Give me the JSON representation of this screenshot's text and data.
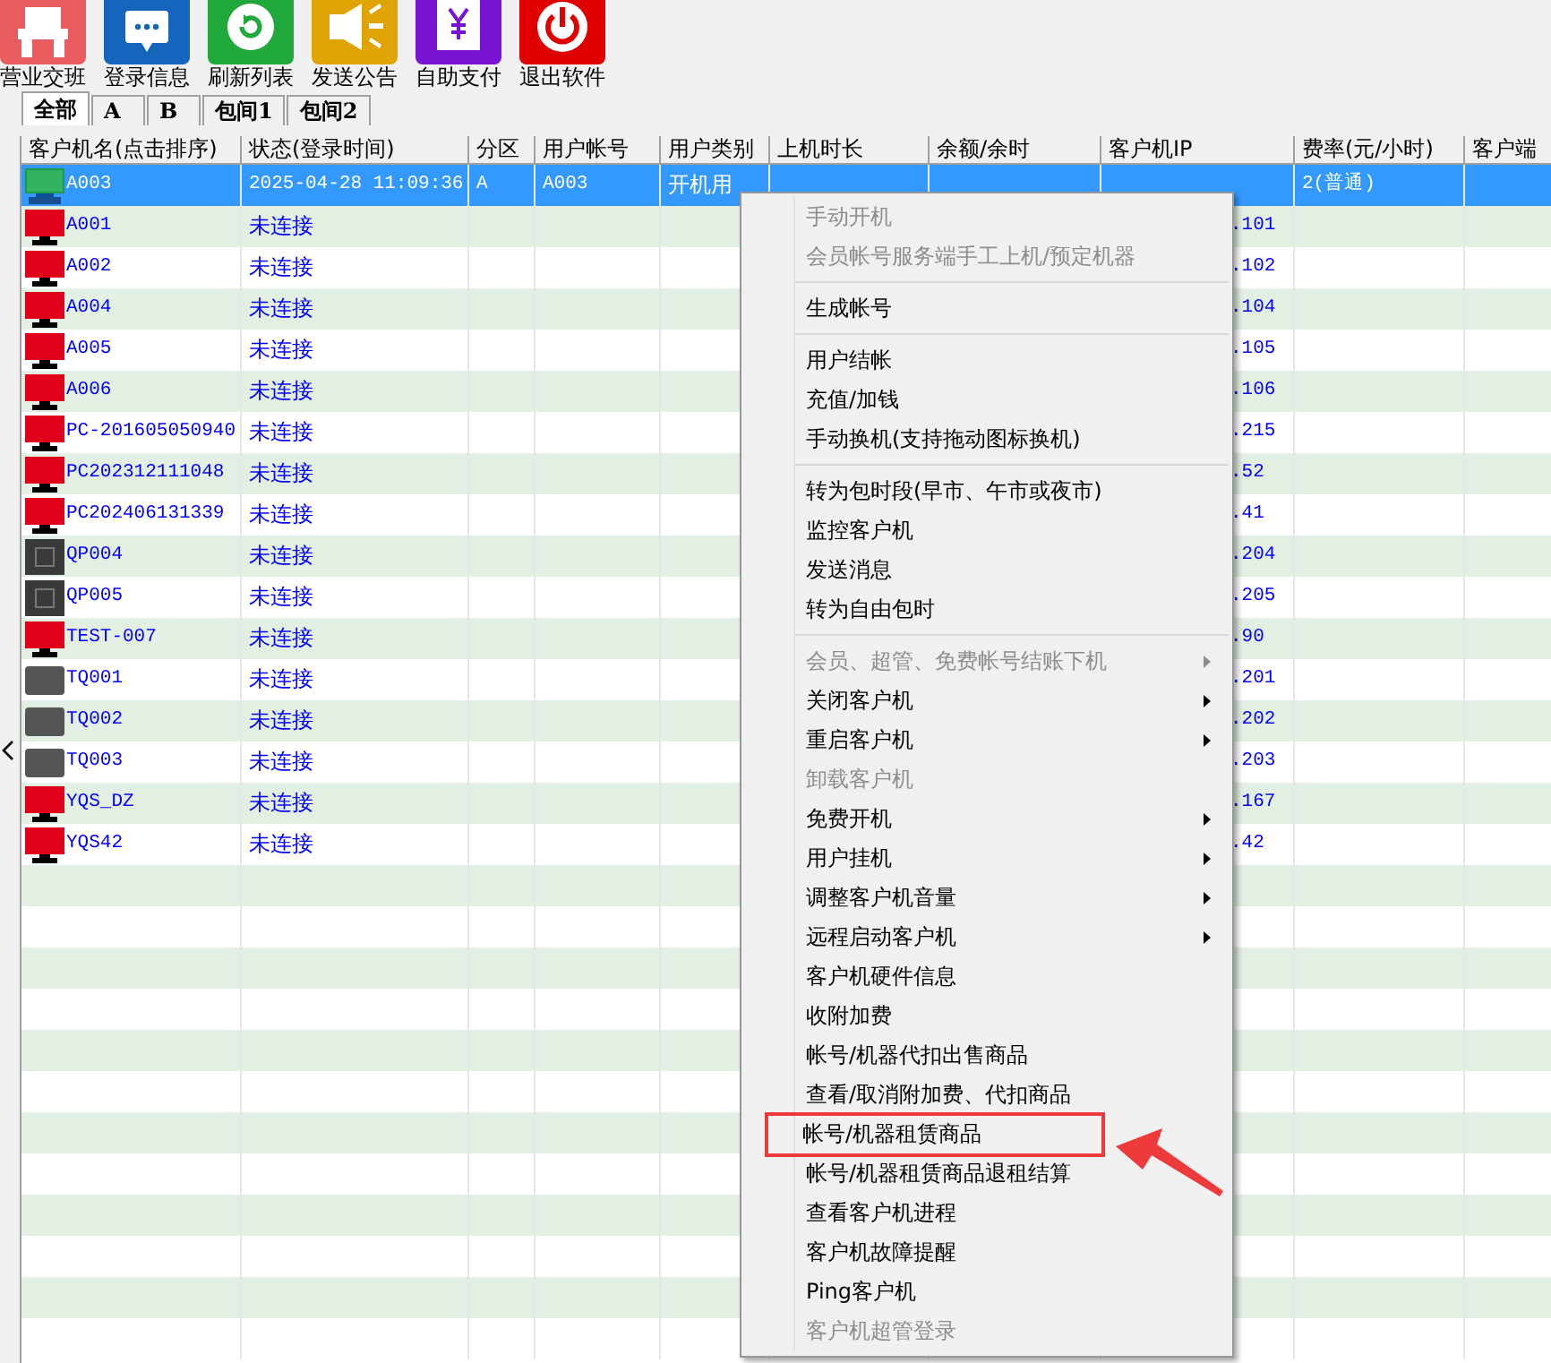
{
  "toolbar": [
    {
      "label": "营业交班",
      "kind": "shift"
    },
    {
      "label": "登录信息",
      "kind": "info"
    },
    {
      "label": "刷新列表",
      "kind": "refresh"
    },
    {
      "label": "发送公告",
      "kind": "announce"
    },
    {
      "label": "自助支付",
      "kind": "pay"
    },
    {
      "label": "退出软件",
      "kind": "exit"
    }
  ],
  "tabs": [
    {
      "label": "全部",
      "selected": true
    },
    {
      "label": "A",
      "selected": false
    },
    {
      "label": "B",
      "selected": false
    },
    {
      "label": "包间1",
      "selected": false
    },
    {
      "label": "包间2",
      "selected": false
    }
  ],
  "table": {
    "columns": [
      "客户机名(点击排序)",
      "状态(登录时间)",
      "分区",
      "用户帐号",
      "用户类别",
      "上机时长",
      "余额/余时",
      "客户机IP",
      "费率(元/小时)",
      "客户端"
    ],
    "rows": [
      {
        "name": "A003",
        "kind": "connected",
        "selected": true,
        "status": "2025-04-28 11:09:36",
        "zone": "A",
        "account": "A003",
        "user_type": "开机用",
        "rate": "2(普通)"
      },
      {
        "name": "A001",
        "kind": "offline",
        "selected": false,
        "status": "未连接",
        "ip": ".101"
      },
      {
        "name": "A002",
        "kind": "offline",
        "selected": false,
        "status": "未连接",
        "ip": ".102"
      },
      {
        "name": "A004",
        "kind": "offline",
        "selected": false,
        "status": "未连接",
        "ip": ".104"
      },
      {
        "name": "A005",
        "kind": "offline",
        "selected": false,
        "status": "未连接",
        "ip": ".105"
      },
      {
        "name": "A006",
        "kind": "offline",
        "selected": false,
        "status": "未连接",
        "ip": ".106"
      },
      {
        "name": "PC-201605050940",
        "kind": "offline",
        "selected": false,
        "status": "未连接",
        "ip": ".215"
      },
      {
        "name": "PC202312111048",
        "kind": "offline",
        "selected": false,
        "status": "未连接",
        "ip": ".52"
      },
      {
        "name": "PC202406131339",
        "kind": "offline",
        "selected": false,
        "status": "未连接",
        "ip": ".41"
      },
      {
        "name": "QP004",
        "kind": "special",
        "selected": false,
        "status": "未连接",
        "ip": ".204"
      },
      {
        "name": "QP005",
        "kind": "special",
        "selected": false,
        "status": "未连接",
        "ip": ".205"
      },
      {
        "name": "TEST-007",
        "kind": "offline",
        "selected": false,
        "status": "未连接",
        "ip": ".90"
      },
      {
        "name": "TQ001",
        "kind": "dormant",
        "selected": false,
        "status": "未连接",
        "ip": ".201"
      },
      {
        "name": "TQ002",
        "kind": "dormant",
        "selected": false,
        "status": "未连接",
        "ip": ".202"
      },
      {
        "name": "TQ003",
        "kind": "dormant",
        "selected": false,
        "status": "未连接",
        "ip": ".203"
      },
      {
        "name": "YQS_DZ",
        "kind": "offline",
        "selected": false,
        "status": "未连接",
        "ip": ".167"
      },
      {
        "name": "YQS42",
        "kind": "offline",
        "selected": false,
        "status": "未连接",
        "ip": ".42"
      }
    ]
  },
  "context_menu": [
    {
      "kind": "item",
      "label": "手动开机",
      "disabled": true,
      "submenu": false,
      "highlighted": false
    },
    {
      "kind": "item",
      "label": "会员帐号服务端手工上机/预定机器",
      "disabled": true,
      "submenu": false,
      "highlighted": false
    },
    {
      "kind": "separator"
    },
    {
      "kind": "item",
      "label": "生成帐号",
      "disabled": false,
      "submenu": false,
      "highlighted": false
    },
    {
      "kind": "separator"
    },
    {
      "kind": "item",
      "label": "用户结帐",
      "disabled": false,
      "submenu": false,
      "highlighted": false
    },
    {
      "kind": "item",
      "label": "充值/加钱",
      "disabled": false,
      "submenu": false,
      "highlighted": false
    },
    {
      "kind": "item",
      "label": "手动换机(支持拖动图标换机)",
      "disabled": false,
      "submenu": false,
      "highlighted": false
    },
    {
      "kind": "separator"
    },
    {
      "kind": "item",
      "label": "转为包时段(早市、午市或夜市)",
      "disabled": false,
      "submenu": false,
      "highlighted": false
    },
    {
      "kind": "item",
      "label": "监控客户机",
      "disabled": false,
      "submenu": false,
      "highlighted": false
    },
    {
      "kind": "item",
      "label": "发送消息",
      "disabled": false,
      "submenu": false,
      "highlighted": false
    },
    {
      "kind": "item",
      "label": "转为自由包时",
      "disabled": false,
      "submenu": false,
      "highlighted": false
    },
    {
      "kind": "separator"
    },
    {
      "kind": "item",
      "label": "会员、超管、免费帐号结账下机",
      "disabled": true,
      "submenu": true,
      "highlighted": false
    },
    {
      "kind": "item",
      "label": "关闭客户机",
      "disabled": false,
      "submenu": true,
      "highlighted": false
    },
    {
      "kind": "item",
      "label": "重启客户机",
      "disabled": false,
      "submenu": true,
      "highlighted": false
    },
    {
      "kind": "item",
      "label": "卸载客户机",
      "disabled": true,
      "submenu": false,
      "highlighted": false
    },
    {
      "kind": "item",
      "label": "免费开机",
      "disabled": false,
      "submenu": true,
      "highlighted": false
    },
    {
      "kind": "item",
      "label": "用户挂机",
      "disabled": false,
      "submenu": true,
      "highlighted": false
    },
    {
      "kind": "item",
      "label": "调整客户机音量",
      "disabled": false,
      "submenu": true,
      "highlighted": false
    },
    {
      "kind": "item",
      "label": "远程启动客户机",
      "disabled": false,
      "submenu": true,
      "highlighted": false
    },
    {
      "kind": "item",
      "label": "客户机硬件信息",
      "disabled": false,
      "submenu": false,
      "highlighted": false
    },
    {
      "kind": "item",
      "label": "收附加费",
      "disabled": false,
      "submenu": false,
      "highlighted": false
    },
    {
      "kind": "item",
      "label": "帐号/机器代扣出售商品",
      "disabled": false,
      "submenu": false,
      "highlighted": false
    },
    {
      "kind": "item",
      "label": "查看/取消附加费、代扣商品",
      "disabled": false,
      "submenu": false,
      "highlighted": false
    },
    {
      "kind": "item",
      "label": "帐号/机器租赁商品",
      "disabled": false,
      "submenu": false,
      "highlighted": true
    },
    {
      "kind": "item",
      "label": "帐号/机器租赁商品退租结算",
      "disabled": false,
      "submenu": false,
      "highlighted": false
    },
    {
      "kind": "item",
      "label": "查看客户机进程",
      "disabled": false,
      "submenu": false,
      "highlighted": false
    },
    {
      "kind": "item",
      "label": "客户机故障提醒",
      "disabled": false,
      "submenu": false,
      "highlighted": false
    },
    {
      "kind": "item",
      "label": "Ping客户机",
      "disabled": false,
      "submenu": false,
      "highlighted": false
    },
    {
      "kind": "item",
      "label": "客户机超管登录",
      "disabled": true,
      "submenu": false,
      "highlighted": false
    }
  ]
}
